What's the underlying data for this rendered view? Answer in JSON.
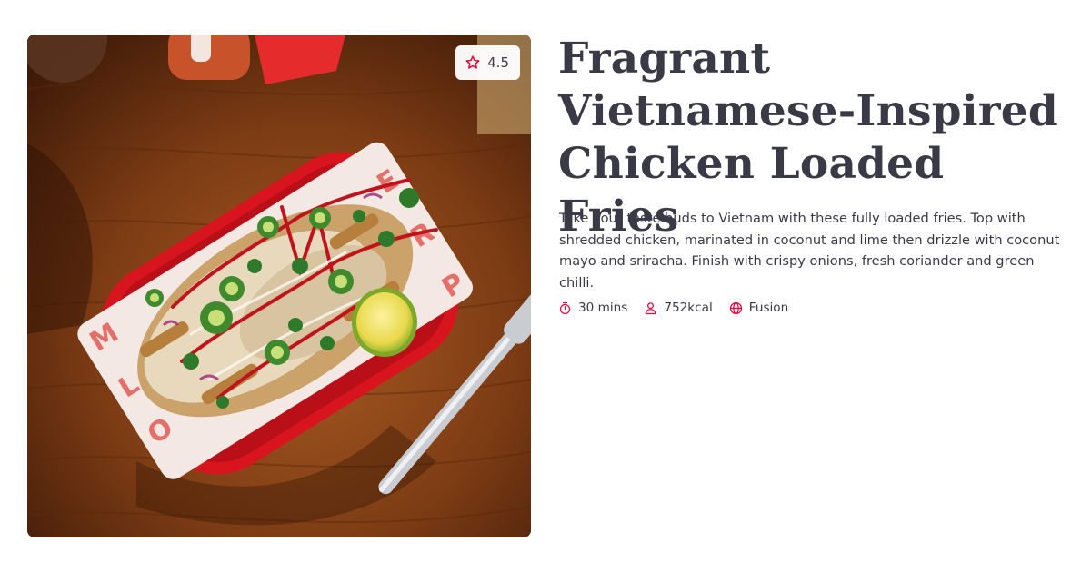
{
  "recipe": {
    "image_alt": "Loaded fries in a red basket on a wooden table",
    "rating": "4.5",
    "title": "Fragrant Vietnamese-Inspired Chicken Loaded Fries",
    "description": "Take your taste buds to Vietnam with these fully loaded fries. Top with shredded chicken, marinated in coconut and lime then drizzle with coconut mayo and sriracha. Finish with crispy onions, fresh coriander and green chilli.",
    "meta": {
      "time": "30 mins",
      "calories": "752kcal",
      "cuisine": "Fusion"
    }
  },
  "icons": {
    "rating": "star-icon",
    "time": "stopwatch-icon",
    "calories": "person-icon",
    "cuisine": "globe-icon"
  },
  "colors": {
    "accent": "#e4003b",
    "text": "#3a3a46",
    "background": "#ffffff"
  }
}
